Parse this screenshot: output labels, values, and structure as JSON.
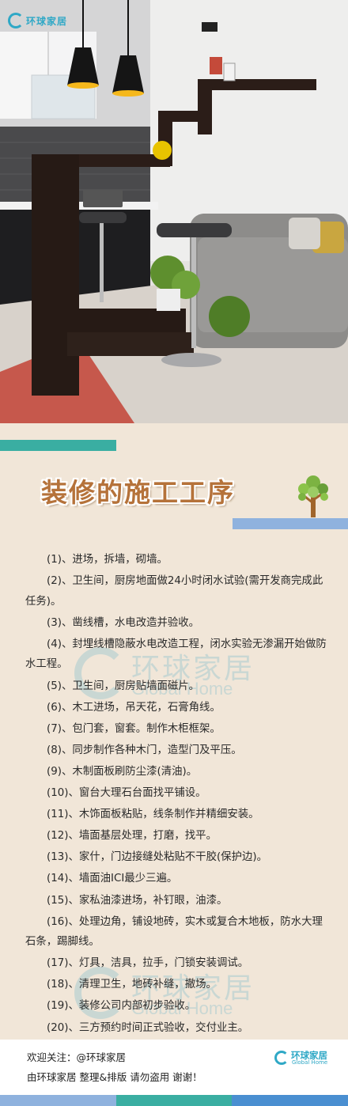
{
  "brand": {
    "logo_text": "环球家居"
  },
  "title": "装修的施工工序",
  "steps": [
    "(1)、进场，拆墙，砌墙。",
    "(2)、卫生间，厨房地面做24小时闭水试验(需开发商完成此任务)。",
    "(3)、凿线槽，水电改造并验收。",
    "(4)、封埋线槽隐蔽水电改造工程，闭水实验无渗漏开始做防水工程。",
    "(5)、卫生间，厨房贴墙面磁片。",
    "(6)、木工进场，吊天花，石膏角线。",
    "(7)、包门套，窗套。制作木柜框架。",
    "(8)、同步制作各种木门，造型门及平压。",
    "(9)、木制面板刷防尘漆(清油)。",
    "(10)、窗台大理石台面找平铺设。",
    "(11)、木饰面板粘贴，线条制作并精细安装。",
    "(12)、墙面基层处理，打磨，找平。",
    "(13)、家什，门边接缝处粘贴不干胶(保护边)。",
    "(14)、墙面油ICI最少三遍。",
    "(15)、家私油漆进场，补钉眼，油漆。",
    "(16)、处理边角，铺设地砖，实木或复合木地板，防水大理石条，踢脚线。",
    "(17)、灯具，洁具，拉手，门锁安装调试。",
    "(18)、清理卫生，地砖补缝，撤场。",
    "(19)、装修公司内部初步验收。",
    "(20)、三方预约时间正式验收，交付业主。"
  ],
  "watermark": {
    "text_zh": "环球家居",
    "text_en": "Global Home"
  },
  "footer": {
    "follow": "欢迎关注：@环球家居",
    "credit": "由环球家居  整理&排版  请勿盗用 谢谢！",
    "logo_zh": "环球家居",
    "logo_en": "Global Home"
  },
  "icons": {
    "title_decoration": "tree-icon",
    "brand_mark": "g-ring-logo"
  },
  "colors": {
    "background": "#f1e6d8",
    "title": "#b5723a",
    "teal_stripe": "#3aaea2",
    "blue_stripe": "#8fb2de",
    "brand": "#2fa8c6",
    "bottom_bar": [
      "#8fb2de",
      "#3aaea2",
      "#4a8fd1"
    ]
  }
}
